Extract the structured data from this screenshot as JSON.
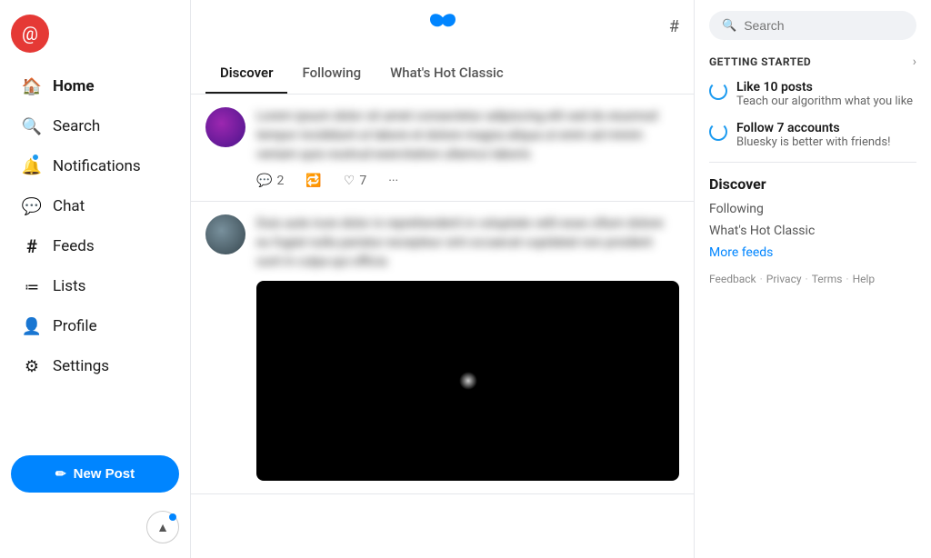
{
  "sidebar": {
    "logo_icon": "@",
    "nav_items": [
      {
        "id": "home",
        "label": "Home",
        "icon": "🏠",
        "active": true
      },
      {
        "id": "search",
        "label": "Search",
        "icon": "🔍",
        "active": false
      },
      {
        "id": "notifications",
        "label": "Notifications",
        "icon": "🔔",
        "active": false,
        "badge": true
      },
      {
        "id": "chat",
        "label": "Chat",
        "icon": "💬",
        "active": false
      },
      {
        "id": "feeds",
        "label": "Feeds",
        "icon": "#",
        "active": false
      },
      {
        "id": "lists",
        "label": "Lists",
        "icon": "≔",
        "active": false
      },
      {
        "id": "profile",
        "label": "Profile",
        "icon": "👤",
        "active": false
      },
      {
        "id": "settings",
        "label": "Settings",
        "icon": "⚙",
        "active": false
      }
    ],
    "new_post_label": "New Post"
  },
  "feed": {
    "tabs": [
      {
        "id": "discover",
        "label": "Discover",
        "active": true
      },
      {
        "id": "following",
        "label": "Following",
        "active": false
      },
      {
        "id": "whats_hot",
        "label": "What's Hot Classic",
        "active": false
      }
    ],
    "posts": [
      {
        "id": "post1",
        "avatar_type": "purple",
        "text_blurred": "Lorem ipsum dolor sit amet consectetur adipiscing elit sed do eiusmod tempor incididunt ut labore et dolore magna aliqua ut enim ad minim veniam quis nostrud exercitation ullamco laboris",
        "reply_count": "2",
        "like_count": "7"
      },
      {
        "id": "post2",
        "avatar_type": "gray",
        "text_blurred": "Duis aute irure dolor in reprehenderit in voluptate velit esse cillum dolore eu fugiat nulla pariatur excepteur sint occaecat cupidatat non proident sunt in culpa qui officia",
        "has_image": true,
        "reply_count": "",
        "like_count": ""
      }
    ]
  },
  "right_sidebar": {
    "search_placeholder": "Search",
    "getting_started": {
      "title": "GETTING STARTED",
      "items": [
        {
          "title": "Like 10 posts",
          "subtitle": "Teach our algorithm what you like"
        },
        {
          "title": "Follow 7 accounts",
          "subtitle": "Bluesky is better with friends!"
        }
      ]
    },
    "discover": {
      "title": "Discover",
      "links": [
        {
          "label": "Following",
          "blue": false
        },
        {
          "label": "What's Hot Classic",
          "blue": false
        },
        {
          "label": "More feeds",
          "blue": true
        }
      ]
    },
    "footer": {
      "links": [
        "Feedback",
        "Privacy",
        "Terms",
        "Help"
      ],
      "separators": [
        "·",
        "·",
        "·"
      ]
    }
  }
}
